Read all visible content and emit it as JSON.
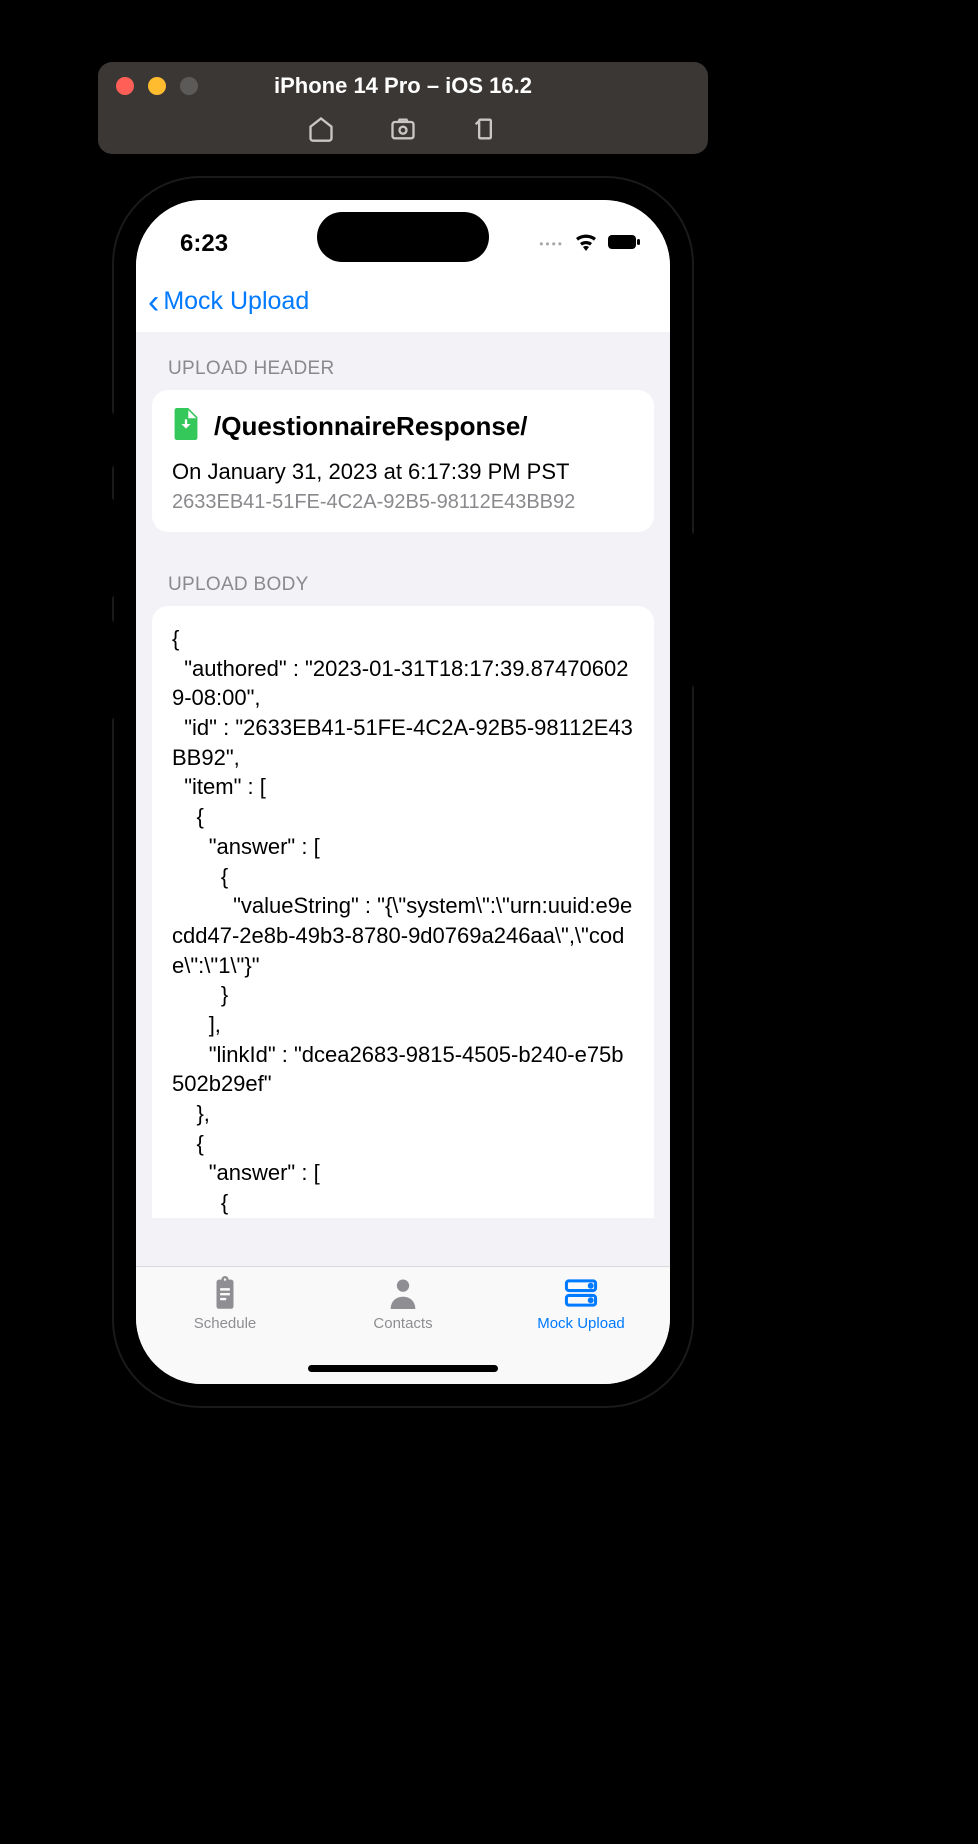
{
  "simulator": {
    "title": "iPhone 14 Pro – iOS 16.2"
  },
  "status": {
    "time": "6:23"
  },
  "nav": {
    "back_label": "Mock Upload"
  },
  "sections": {
    "header_label": "UPLOAD HEADER",
    "body_label": "UPLOAD BODY"
  },
  "upload_header": {
    "path": "/QuestionnaireResponse/",
    "date": "On January 31, 2023 at 6:17:39 PM PST",
    "uuid": "2633EB41-51FE-4C2A-92B5-98112E43BB92"
  },
  "upload_body": {
    "text": "{\n  \"authored\" : \"2023-01-31T18:17:39.874706029-08:00\",\n  \"id\" : \"2633EB41-51FE-4C2A-92B5-98112E43BB92\",\n  \"item\" : [\n    {\n      \"answer\" : [\n        {\n          \"valueString\" : \"{\\\"system\\\":\\\"urn:uuid:e9ecdd47-2e8b-49b3-8780-9d0769a246aa\\\",\\\"code\\\":\\\"1\\\"}\"\n        }\n      ],\n      \"linkId\" : \"dcea2683-9815-4505-b240-e75b502b29ef\"\n    },\n    {\n      \"answer\" : [\n        {"
  },
  "tabs": {
    "schedule": "Schedule",
    "contacts": "Contacts",
    "mock_upload": "Mock Upload"
  }
}
